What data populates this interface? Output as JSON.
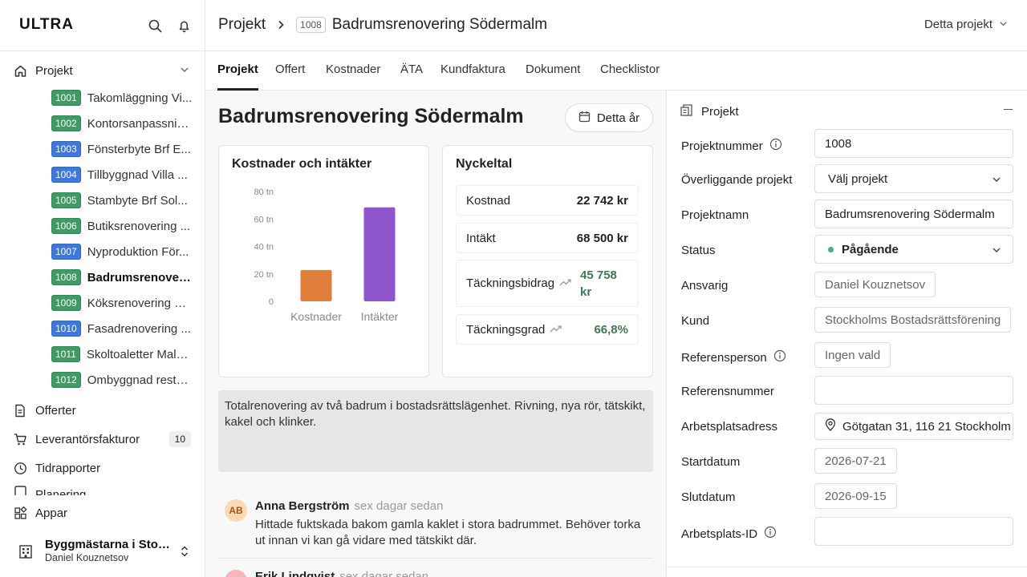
{
  "brand": {
    "logo": "ULTRA"
  },
  "sidebar": {
    "projects_label": "Projekt",
    "projects": [
      {
        "num": "1001",
        "name": "Takomläggning Vi...",
        "color": "#3f9a63"
      },
      {
        "num": "1002",
        "name": "Kontorsanpassnin...",
        "color": "#3f9a63"
      },
      {
        "num": "1003",
        "name": "Fönsterbyte Brf E...",
        "color": "#3f78d8"
      },
      {
        "num": "1004",
        "name": "Tillbyggnad Villa ...",
        "color": "#3f78d8"
      },
      {
        "num": "1005",
        "name": "Stambyte Brf Sol...",
        "color": "#3f9a63"
      },
      {
        "num": "1006",
        "name": "Butiksrenovering ...",
        "color": "#3f9a63"
      },
      {
        "num": "1007",
        "name": "Nyproduktion För...",
        "color": "#3f78d8"
      },
      {
        "num": "1008",
        "name": "Badrumsrenoveri...",
        "color": "#3f9a63"
      },
      {
        "num": "1009",
        "name": "Köksrenovering U...",
        "color": "#3f9a63"
      },
      {
        "num": "1010",
        "name": "Fasadrenovering ...",
        "color": "#3f78d8"
      },
      {
        "num": "1011",
        "name": "Skoltoaletter Malmö",
        "color": "#3f9a63"
      },
      {
        "num": "1012",
        "name": "Ombyggnad resta...",
        "color": "#3f9a63"
      }
    ],
    "offers": "Offerter",
    "supplier_invoices": "Leverantörsfakturor",
    "supplier_invoices_count": "10",
    "time_reports": "Tidrapporter",
    "partial": "Planering",
    "apps": "Appar",
    "company_name": "Byggmästarna i Stoc...",
    "company_user": "Daniel Kouznetsov"
  },
  "header": {
    "breadcrumb_root": "Projekt",
    "project_number": "1008",
    "project_name": "Badrumsrenovering Södermalm",
    "scope": "Detta projekt"
  },
  "tabs": [
    "Projekt",
    "Offert",
    "Kostnader",
    "ÄTA",
    "Kundfaktura",
    "Dokument",
    "Checklistor"
  ],
  "main": {
    "title": "Badrumsrenovering Södermalm",
    "period_button": "Detta år",
    "description": "Totalrenovering av två badrum i bostadsrättslägenhet. Rivning, nya rör, tätskikt, kakel och klinker."
  },
  "chart_data": {
    "type": "bar",
    "title": "Kostnader och intäkter",
    "categories": [
      "Kostnader",
      "Intäkter"
    ],
    "values": [
      22742,
      68500
    ],
    "colors": [
      "#e07f3c",
      "#8f55cc"
    ],
    "yticks": [
      "80 tn",
      "60 tn",
      "40 tn",
      "20 tn",
      "0"
    ],
    "ylim": [
      0,
      80000
    ],
    "grid": false
  },
  "kpis": {
    "title": "Nyckeltal",
    "items": [
      {
        "label": "Kostnad",
        "value": "22 742 kr",
        "trend": false
      },
      {
        "label": "Intäkt",
        "value": "68 500 kr",
        "trend": false
      },
      {
        "label": "Täckningsbidrag",
        "value": "45 758 kr",
        "trend": true
      },
      {
        "label": "Täckningsgrad",
        "value": "66,8%",
        "trend": true
      }
    ]
  },
  "comments": [
    {
      "initials": "AB",
      "author": "Anna Bergström",
      "time": "sex dagar sedan",
      "text": "Hittade fuktskada bakom gamla kaklet i stora badrummet. Behöver torka ut innan vi kan gå vidare med tätskikt där.",
      "avatar_bg": "#fbd9b4",
      "avatar_fg": "#a35a12"
    },
    {
      "initials": "EL",
      "author": "Erik Lindqvist",
      "time": "sex dagar sedan",
      "text": "",
      "avatar_bg": "#f5b6b6",
      "avatar_fg": "#a33"
    }
  ],
  "panel": {
    "title": "Projekt",
    "fields": [
      {
        "label": "Projektnummer",
        "value": "1008",
        "info": true,
        "type": "input"
      },
      {
        "label": "Överliggande projekt",
        "value": "Välj projekt",
        "info": false,
        "type": "select"
      },
      {
        "label": "Projektnamn",
        "value": "Badrumsrenovering Södermalm",
        "info": false,
        "type": "input"
      },
      {
        "label": "Status",
        "value": "Pågående",
        "info": false,
        "type": "status"
      },
      {
        "label": "Ansvarig",
        "value": "Daniel Kouznetsov",
        "info": false,
        "type": "chip"
      },
      {
        "label": "Kund",
        "value": "Stockholms Bostadsrättsförening",
        "info": false,
        "type": "chip"
      },
      {
        "label": "Referensperson",
        "value": "Ingen vald",
        "info": true,
        "type": "chip"
      },
      {
        "label": "Referensnummer",
        "value": "",
        "info": false,
        "type": "input"
      },
      {
        "label": "Arbetsplatsadress",
        "value": "Götgatan 31, 116 21 Stockholm",
        "info": false,
        "type": "address"
      },
      {
        "label": "Startdatum",
        "value": "2026-07-21",
        "info": false,
        "type": "chip"
      },
      {
        "label": "Slutdatum",
        "value": "2026-09-15",
        "info": false,
        "type": "chip"
      },
      {
        "label": "Arbetsplats-ID",
        "value": "",
        "info": true,
        "type": "input"
      }
    ]
  }
}
